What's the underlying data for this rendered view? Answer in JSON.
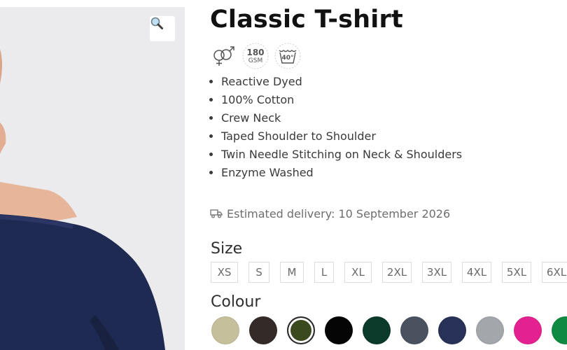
{
  "product": {
    "title": "Classic T-shirt",
    "badges": [
      {
        "icon": "unisex-icon"
      },
      {
        "icon": "fabric-weight-icon",
        "line1": "180",
        "line2": "GSM"
      },
      {
        "icon": "wash-40-icon",
        "text": "40°"
      }
    ],
    "features": [
      "Reactive Dyed",
      "100% Cotton",
      "Crew Neck",
      "Taped Shoulder to Shoulder",
      "Twin Needle Stitching on Neck & Shoulders",
      "Enzyme Washed"
    ],
    "delivery": {
      "icon": "truck-icon",
      "text": "Estimated delivery: 10 September 2026"
    }
  },
  "gallery": {
    "zoom_icon": "magnifier-icon",
    "shirt_color": "#1f2a52"
  },
  "size": {
    "label": "Size",
    "options": [
      "XS",
      "S",
      "M",
      "L",
      "XL",
      "2XL",
      "3XL",
      "4XL",
      "5XL",
      "6XL"
    ]
  },
  "colour": {
    "label": "Colour",
    "selected_index": 2,
    "swatches": [
      "#c5bf9c",
      "#342a28",
      "#3b4a1e",
      "#050505",
      "#0a3a2a",
      "#4a5260",
      "#283259",
      "#a3a6aa",
      "#e3218f",
      "#108a42"
    ]
  }
}
